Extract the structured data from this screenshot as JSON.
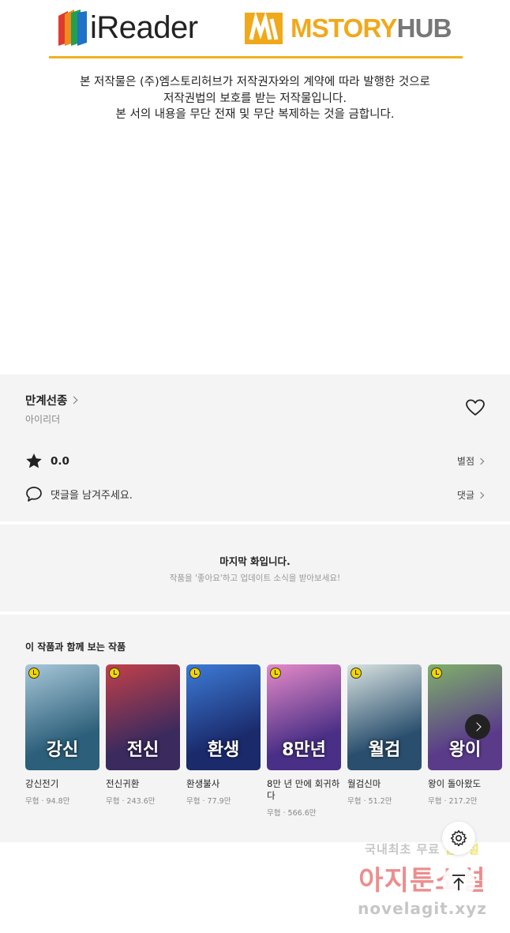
{
  "banner": {
    "ireader_logo": "iReader",
    "mstory_logo_a": "MSTORY",
    "mstory_logo_b": "HUB",
    "notice_lines": [
      "본 저작물은 (주)엠스토리허브가 저작권자와의 계약에 따라 발행한 것으로",
      "저작권법의 보호를 받는 저작물입니다.",
      "본 서의 내용을 무단 전재 및 무단 복제하는 것을 금합니다."
    ]
  },
  "series": {
    "title": "만계선종",
    "author": "아이리더",
    "rating": "0.0",
    "rating_link": "별점",
    "comment_prompt": "댓글을 남겨주세요.",
    "comment_link": "댓글"
  },
  "last_episode": {
    "title": "마지막 화입니다.",
    "subtitle": "작품을 '좋아요'하고 업데이트 소식을 받아보세요!"
  },
  "recommendations": {
    "heading": "이 작품과 함께 보는 작품",
    "items": [
      {
        "name": "강신전기",
        "genre": "무협",
        "views": "94.8만",
        "cover_text": "강신",
        "color_a": "#2c5f7a",
        "color_b": "#a7c7d8"
      },
      {
        "name": "전신귀환",
        "genre": "무협",
        "views": "243.6만",
        "cover_text": "전신",
        "color_a": "#3a2a5e",
        "color_b": "#c2404a"
      },
      {
        "name": "환생불사",
        "genre": "무협",
        "views": "77.9만",
        "cover_text": "환생",
        "color_a": "#1a2a6b",
        "color_b": "#3d7bd6"
      },
      {
        "name": "8만 년 만에 회귀하다",
        "genre": "무협",
        "views": "566.6만",
        "cover_text": "8만년",
        "color_a": "#4a2f86",
        "color_b": "#e58ac8"
      },
      {
        "name": "월검신마",
        "genre": "무협",
        "views": "51.2만",
        "cover_text": "월검",
        "color_a": "#2a4f6e",
        "color_b": "#d8e2e0"
      },
      {
        "name": "왕이 돌아왔도",
        "genre": "무협",
        "views": "217.2만",
        "cover_text": "왕이",
        "color_a": "#5a3b8a",
        "color_b": "#7fb06a"
      }
    ]
  },
  "watermark": {
    "line1a": "국내최초 무료",
    "line1b": "웹소설",
    "line2": "아지툰소설",
    "line3": "novelagit.xyz"
  },
  "icons": [
    "heart-icon",
    "star-icon",
    "comment-icon",
    "chevron-right-icon",
    "gear-icon",
    "arrow-up-icon",
    "clock-badge-icon"
  ]
}
